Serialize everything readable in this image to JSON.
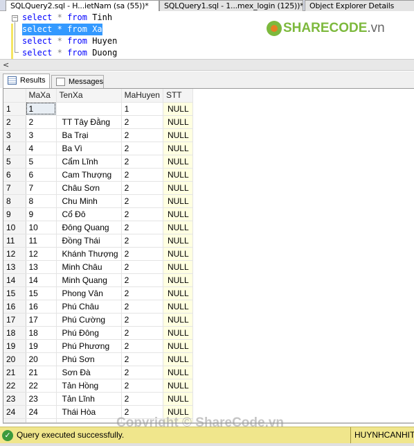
{
  "tabs": [
    {
      "label": "SQLQuery2.sql - H...ietNam (sa (55))*",
      "active": true
    },
    {
      "label": "SQLQuery1.sql - 1...mex_login (125))*",
      "active": false
    },
    {
      "label": "Object Explorer Details",
      "active": false
    }
  ],
  "editor": {
    "lines": [
      {
        "kw": "select",
        "op": "*",
        "kw2": "from",
        "table": "Tinh"
      },
      {
        "kw": "select",
        "op": "*",
        "kw2": "from",
        "table": "Xa",
        "selected": true
      },
      {
        "kw": "select",
        "op": "*",
        "kw2": "from",
        "table": "Huyen"
      },
      {
        "kw": "select",
        "op": "*",
        "kw2": "from",
        "table": "Duong"
      }
    ]
  },
  "logo": {
    "text": "SHARECODE",
    "domain": ".vn"
  },
  "results_tabs": [
    {
      "label": "Results",
      "icon": "grid-icon"
    },
    {
      "label": "Messages",
      "icon": "messages-icon"
    }
  ],
  "grid": {
    "columns": [
      "MaXa",
      "TenXa",
      "MaHuyen",
      "STT"
    ],
    "rows": [
      [
        "1",
        "1",
        "",
        "1",
        "NULL"
      ],
      [
        "2",
        "2",
        "TT Tây Đằng",
        "2",
        "NULL"
      ],
      [
        "3",
        "3",
        "Ba Trại",
        "2",
        "NULL"
      ],
      [
        "4",
        "4",
        "Ba Vì",
        "2",
        "NULL"
      ],
      [
        "5",
        "5",
        "Cẩm Lĩnh",
        "2",
        "NULL"
      ],
      [
        "6",
        "6",
        "Cam Thượng",
        "2",
        "NULL"
      ],
      [
        "7",
        "7",
        "Châu Sơn",
        "2",
        "NULL"
      ],
      [
        "8",
        "8",
        "Chu Minh",
        "2",
        "NULL"
      ],
      [
        "9",
        "9",
        "Cổ Đô",
        "2",
        "NULL"
      ],
      [
        "10",
        "10",
        "Đông Quang",
        "2",
        "NULL"
      ],
      [
        "11",
        "11",
        "Đồng Thái",
        "2",
        "NULL"
      ],
      [
        "12",
        "12",
        "Khánh Thượng",
        "2",
        "NULL"
      ],
      [
        "13",
        "13",
        "Minh Châu",
        "2",
        "NULL"
      ],
      [
        "14",
        "14",
        "Minh Quang",
        "2",
        "NULL"
      ],
      [
        "15",
        "15",
        "Phong Vân",
        "2",
        "NULL"
      ],
      [
        "16",
        "16",
        "Phú Châu",
        "2",
        "NULL"
      ],
      [
        "17",
        "17",
        "Phú Cường",
        "2",
        "NULL"
      ],
      [
        "18",
        "18",
        "Phú Đông",
        "2",
        "NULL"
      ],
      [
        "19",
        "19",
        "Phú Phương",
        "2",
        "NULL"
      ],
      [
        "20",
        "20",
        "Phú Sơn",
        "2",
        "NULL"
      ],
      [
        "21",
        "21",
        "Sơn Đà",
        "2",
        "NULL"
      ],
      [
        "22",
        "22",
        "Tản Hồng",
        "2",
        "NULL"
      ],
      [
        "23",
        "23",
        "Tản Lĩnh",
        "2",
        "NULL"
      ],
      [
        "24",
        "24",
        "Thái Hòa",
        "2",
        "NULL"
      ]
    ]
  },
  "watermark": "Copyright © ShareCode.vn",
  "status": {
    "message": "Query executed successfully.",
    "server": "HUYNHCANHIT"
  }
}
